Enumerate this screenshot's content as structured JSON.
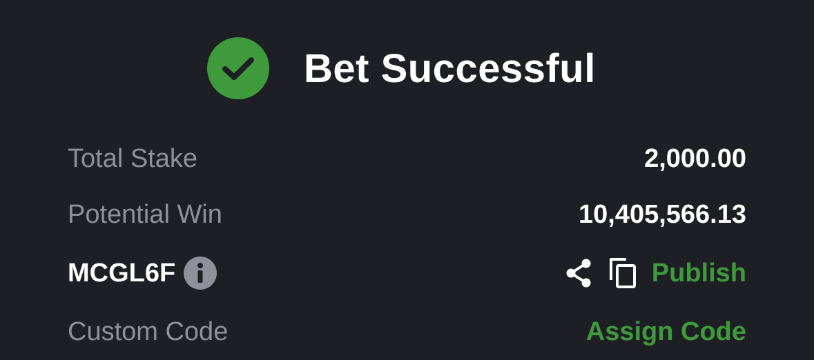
{
  "header": {
    "title": "Bet Successful",
    "icon": "check-circle-icon",
    "icon_color": "#3f9a3c"
  },
  "summary": {
    "stake_label": "Total Stake",
    "stake_value": "2,000.00",
    "win_label": "Potential Win",
    "win_value": "10,405,566.13"
  },
  "booking": {
    "code": "MCGL6F",
    "info_icon": "info-icon",
    "share_icon": "share-icon",
    "copy_icon": "copy-icon",
    "publish_label": "Publish"
  },
  "custom_code": {
    "label": "Custom Code",
    "action_label": "Assign Code"
  },
  "colors": {
    "background": "#1e1f24",
    "accent_green": "#3f9a3c",
    "muted_text": "#8f919a",
    "primary_text": "#ffffff"
  }
}
